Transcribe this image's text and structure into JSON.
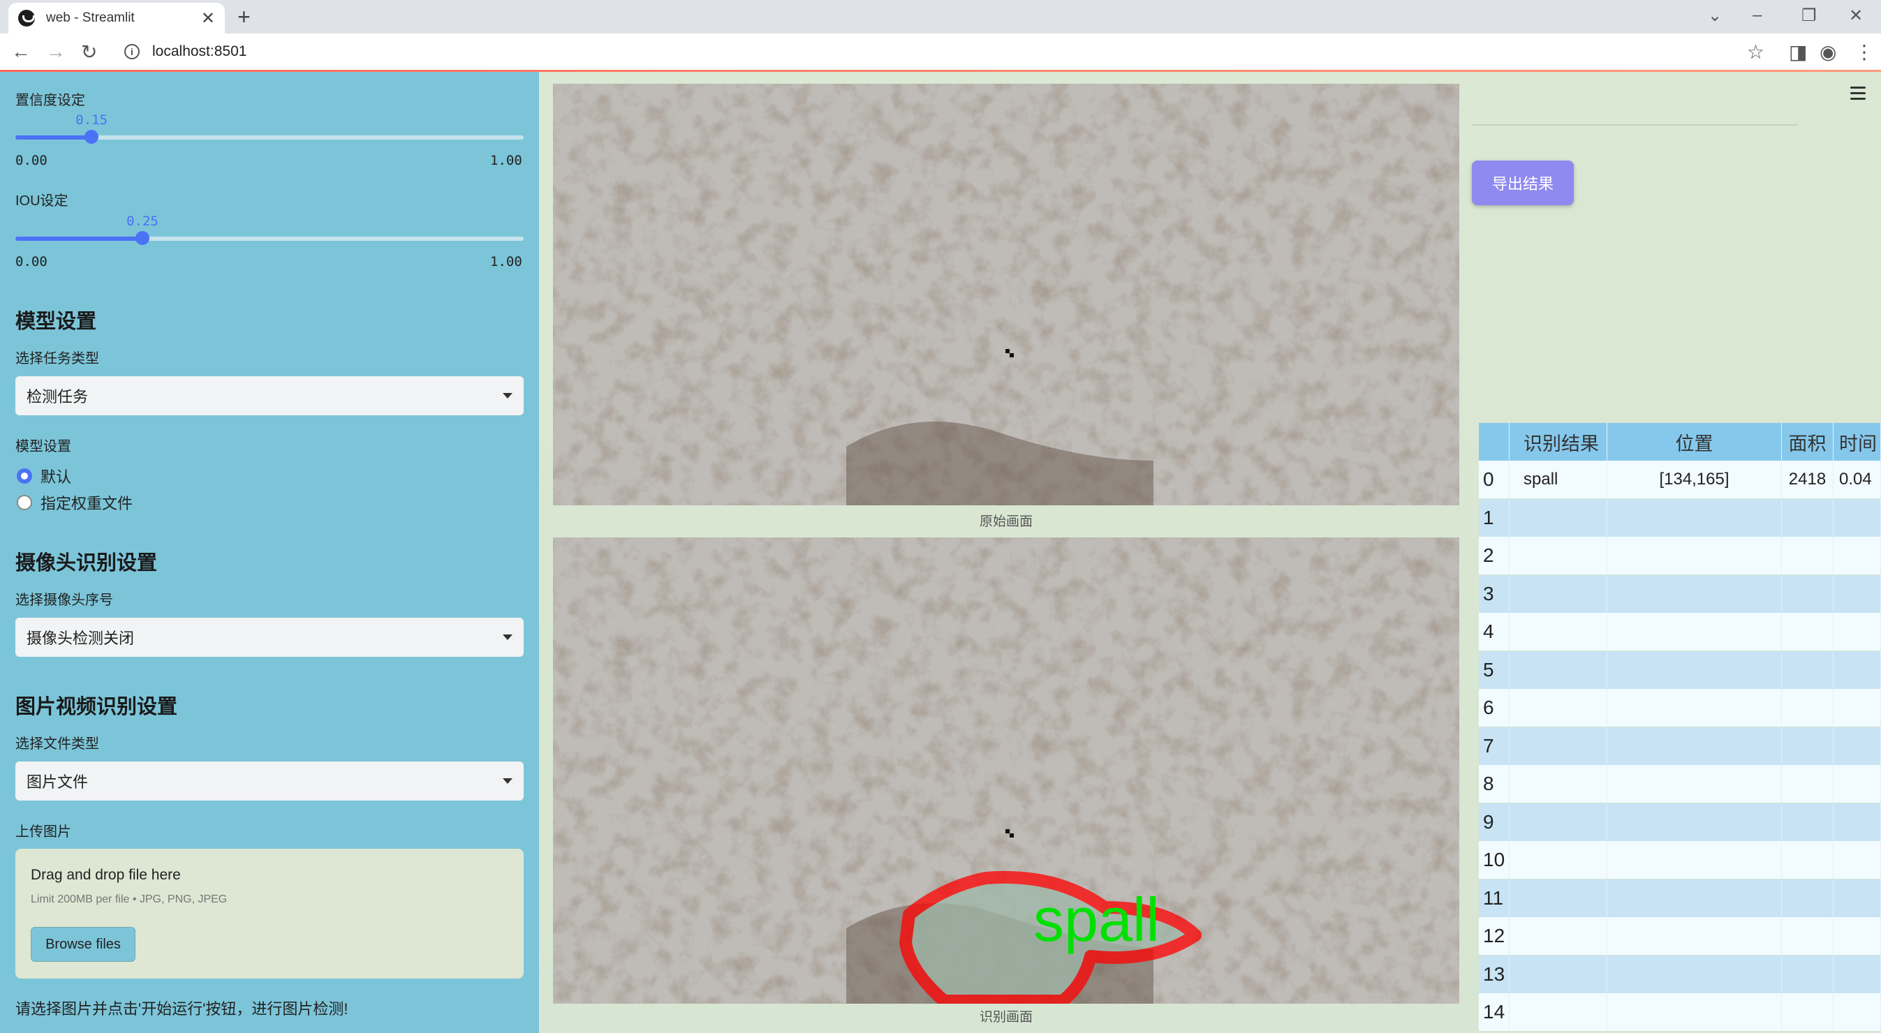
{
  "browser": {
    "tab_title": "web - Streamlit",
    "url": "localhost:8501"
  },
  "sidebar": {
    "conf_label": "置信度设定",
    "conf_value": "0.15",
    "conf_fraction": 0.15,
    "conf_min": "0.00",
    "conf_max": "1.00",
    "iou_label": "IOU设定",
    "iou_value": "0.25",
    "iou_fraction": 0.25,
    "iou_min": "0.00",
    "iou_max": "1.00",
    "model_header": "模型设置",
    "task_label": "选择任务类型",
    "task_value": "检测任务",
    "model_label": "模型设置",
    "radio_default": "默认",
    "radio_custom": "指定权重文件",
    "camera_header": "摄像头识别设置",
    "camera_label": "选择摄像头序号",
    "camera_value": "摄像头检测关闭",
    "file_header": "图片视频识别设置",
    "file_type_label": "选择文件类型",
    "file_type_value": "图片文件",
    "upload_label": "上传图片",
    "drop_text": "Drag and drop file here",
    "limit_text": "Limit 200MB per file • JPG, PNG, JPEG",
    "browse_label": "Browse files",
    "hint": "请选择图片并点击'开始运行'按钮，进行图片检测!"
  },
  "main": {
    "original_caption": "原始画面",
    "result_caption": "识别画面",
    "detection_label": "spall",
    "export_label": "导出结果"
  },
  "table": {
    "headers": [
      "",
      "识别结果",
      "位置",
      "面积",
      "时间"
    ],
    "rows": [
      [
        "0",
        "spall",
        "[134,165]",
        "2418",
        "0.04"
      ],
      [
        "1",
        "",
        "",
        "",
        ""
      ],
      [
        "2",
        "",
        "",
        "",
        ""
      ],
      [
        "3",
        "",
        "",
        "",
        ""
      ],
      [
        "4",
        "",
        "",
        "",
        ""
      ],
      [
        "5",
        "",
        "",
        "",
        ""
      ],
      [
        "6",
        "",
        "",
        "",
        ""
      ],
      [
        "7",
        "",
        "",
        "",
        ""
      ],
      [
        "8",
        "",
        "",
        "",
        ""
      ],
      [
        "9",
        "",
        "",
        "",
        ""
      ],
      [
        "10",
        "",
        "",
        "",
        ""
      ],
      [
        "11",
        "",
        "",
        "",
        ""
      ],
      [
        "12",
        "",
        "",
        "",
        ""
      ],
      [
        "13",
        "",
        "",
        "",
        ""
      ],
      [
        "14",
        "",
        "",
        "",
        ""
      ]
    ]
  },
  "colors": {
    "sidebar_bg": "#7cc5d9",
    "accent": "#4a72f5",
    "export_button": "#8f8af0",
    "detection_box": "#ff0000",
    "detection_text": "#00e000"
  }
}
